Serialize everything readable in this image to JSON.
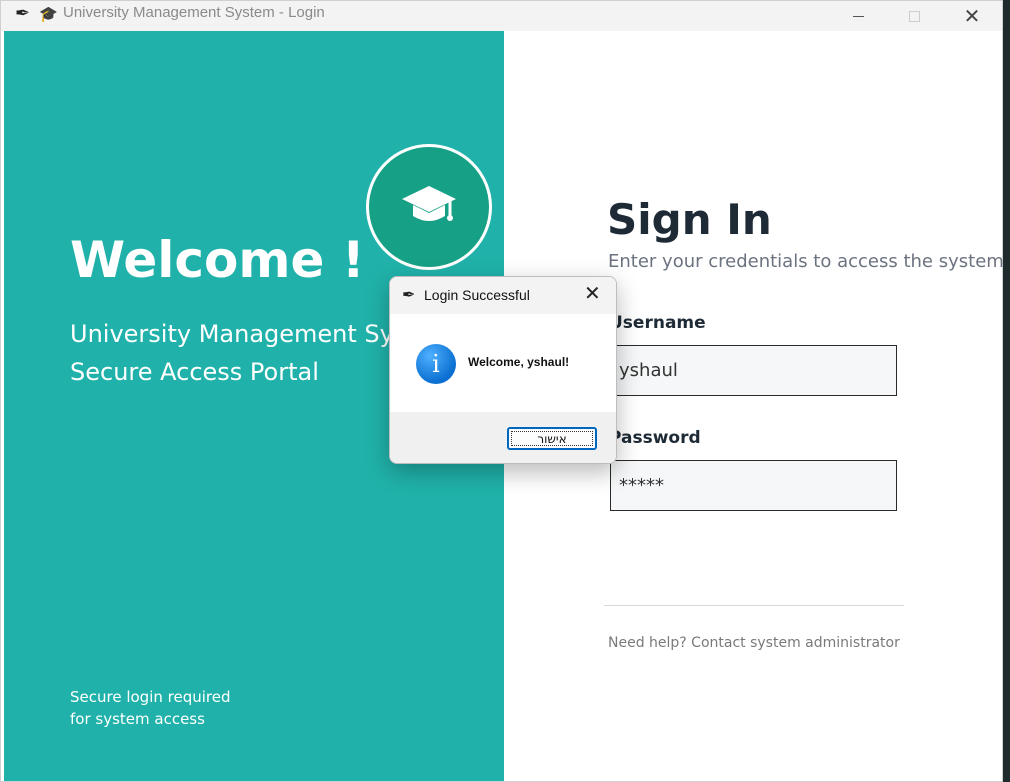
{
  "window": {
    "title": "University Management System - Login",
    "app_icon": "feather-icon",
    "title_icon": "graduation-cap-icon"
  },
  "left_panel": {
    "background": "#20b2aa",
    "welcome": "Welcome !",
    "subtitle_line1": "University Management Sys",
    "subtitle_line2": "Secure Access Portal",
    "footnote_line1": "Secure login required",
    "footnote_line2": "for system access",
    "logo_icon": "graduation-cap-icon"
  },
  "right_panel": {
    "title": "Sign In",
    "subtitle": "Enter your credentials to access the system",
    "username_label": "Username",
    "username_value": "yshaul",
    "password_label": "Password",
    "password_value": "*****",
    "help_text": "Need help? Contact system administrator"
  },
  "dialog": {
    "title": "Login Successful",
    "message": "Welcome, yshaul!",
    "ok_label": "אישור",
    "icon": "info-icon"
  }
}
